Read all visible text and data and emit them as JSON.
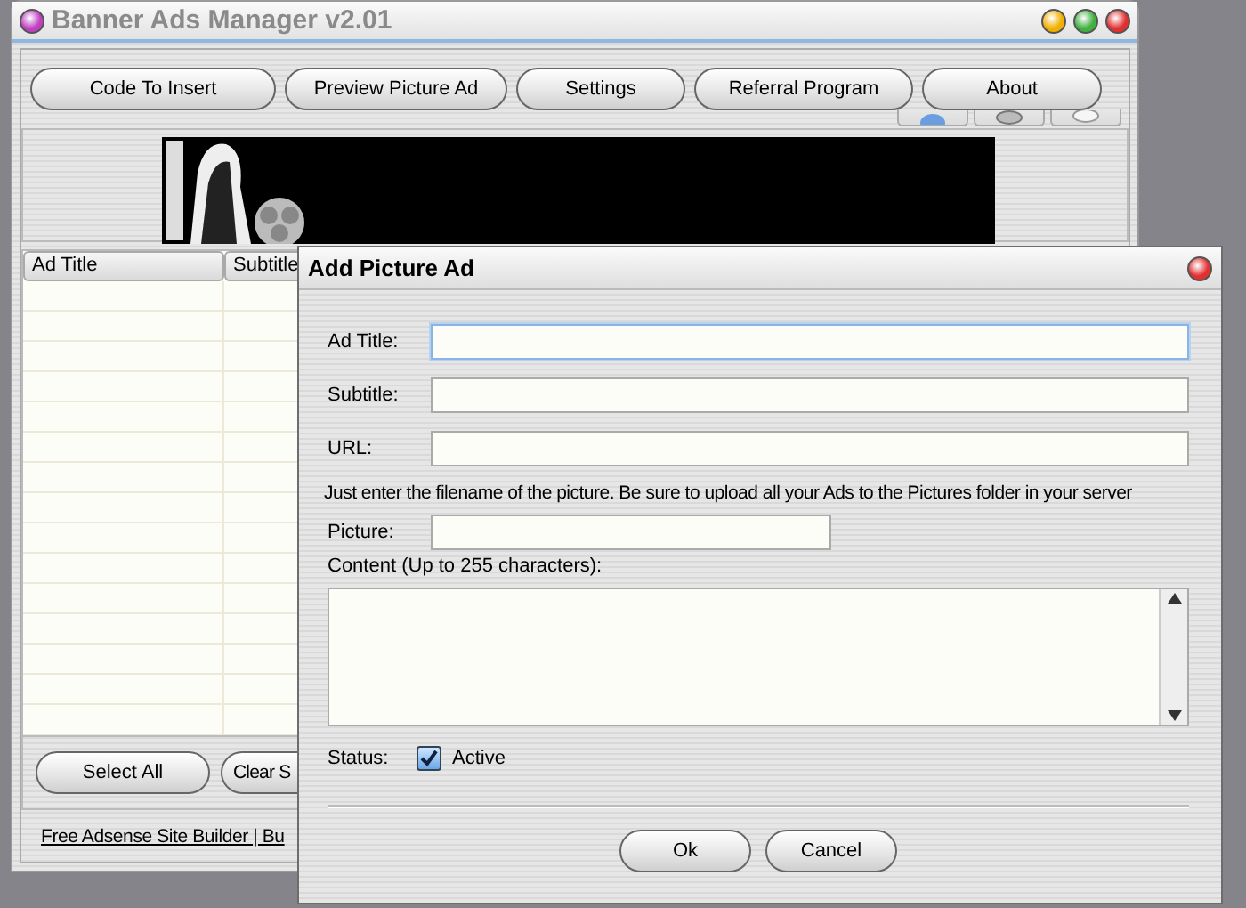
{
  "window": {
    "title": "Banner Ads Manager v2.01"
  },
  "toolbar": {
    "buttons": [
      "Code To Insert",
      "Preview Picture Ad",
      "Settings",
      "Referral Program",
      "About"
    ]
  },
  "banner": {
    "kind": "picture"
  },
  "table": {
    "columns": [
      "Ad Title",
      "Subtitle"
    ]
  },
  "bottom_buttons": [
    "Select All",
    "Clear S"
  ],
  "footer_link": "Free Adsense Site Builder | Bu",
  "dialog": {
    "title": "Add Picture Ad",
    "fields": [
      {
        "label": "Ad Title:",
        "focused": true
      },
      {
        "label": "Subtitle:",
        "focused": false
      },
      {
        "label": "URL:",
        "focused": false
      }
    ],
    "note": "Just enter the filename of the picture. Be sure to upload all your Ads to the Pictures folder in your server",
    "picture_field": {
      "label": "Picture:"
    },
    "content": {
      "label": "Content (Up to 255 characters):"
    },
    "status": {
      "label": "Status:",
      "option": "Active",
      "checked": true
    },
    "buttons": [
      "Ok",
      "Cancel"
    ]
  }
}
